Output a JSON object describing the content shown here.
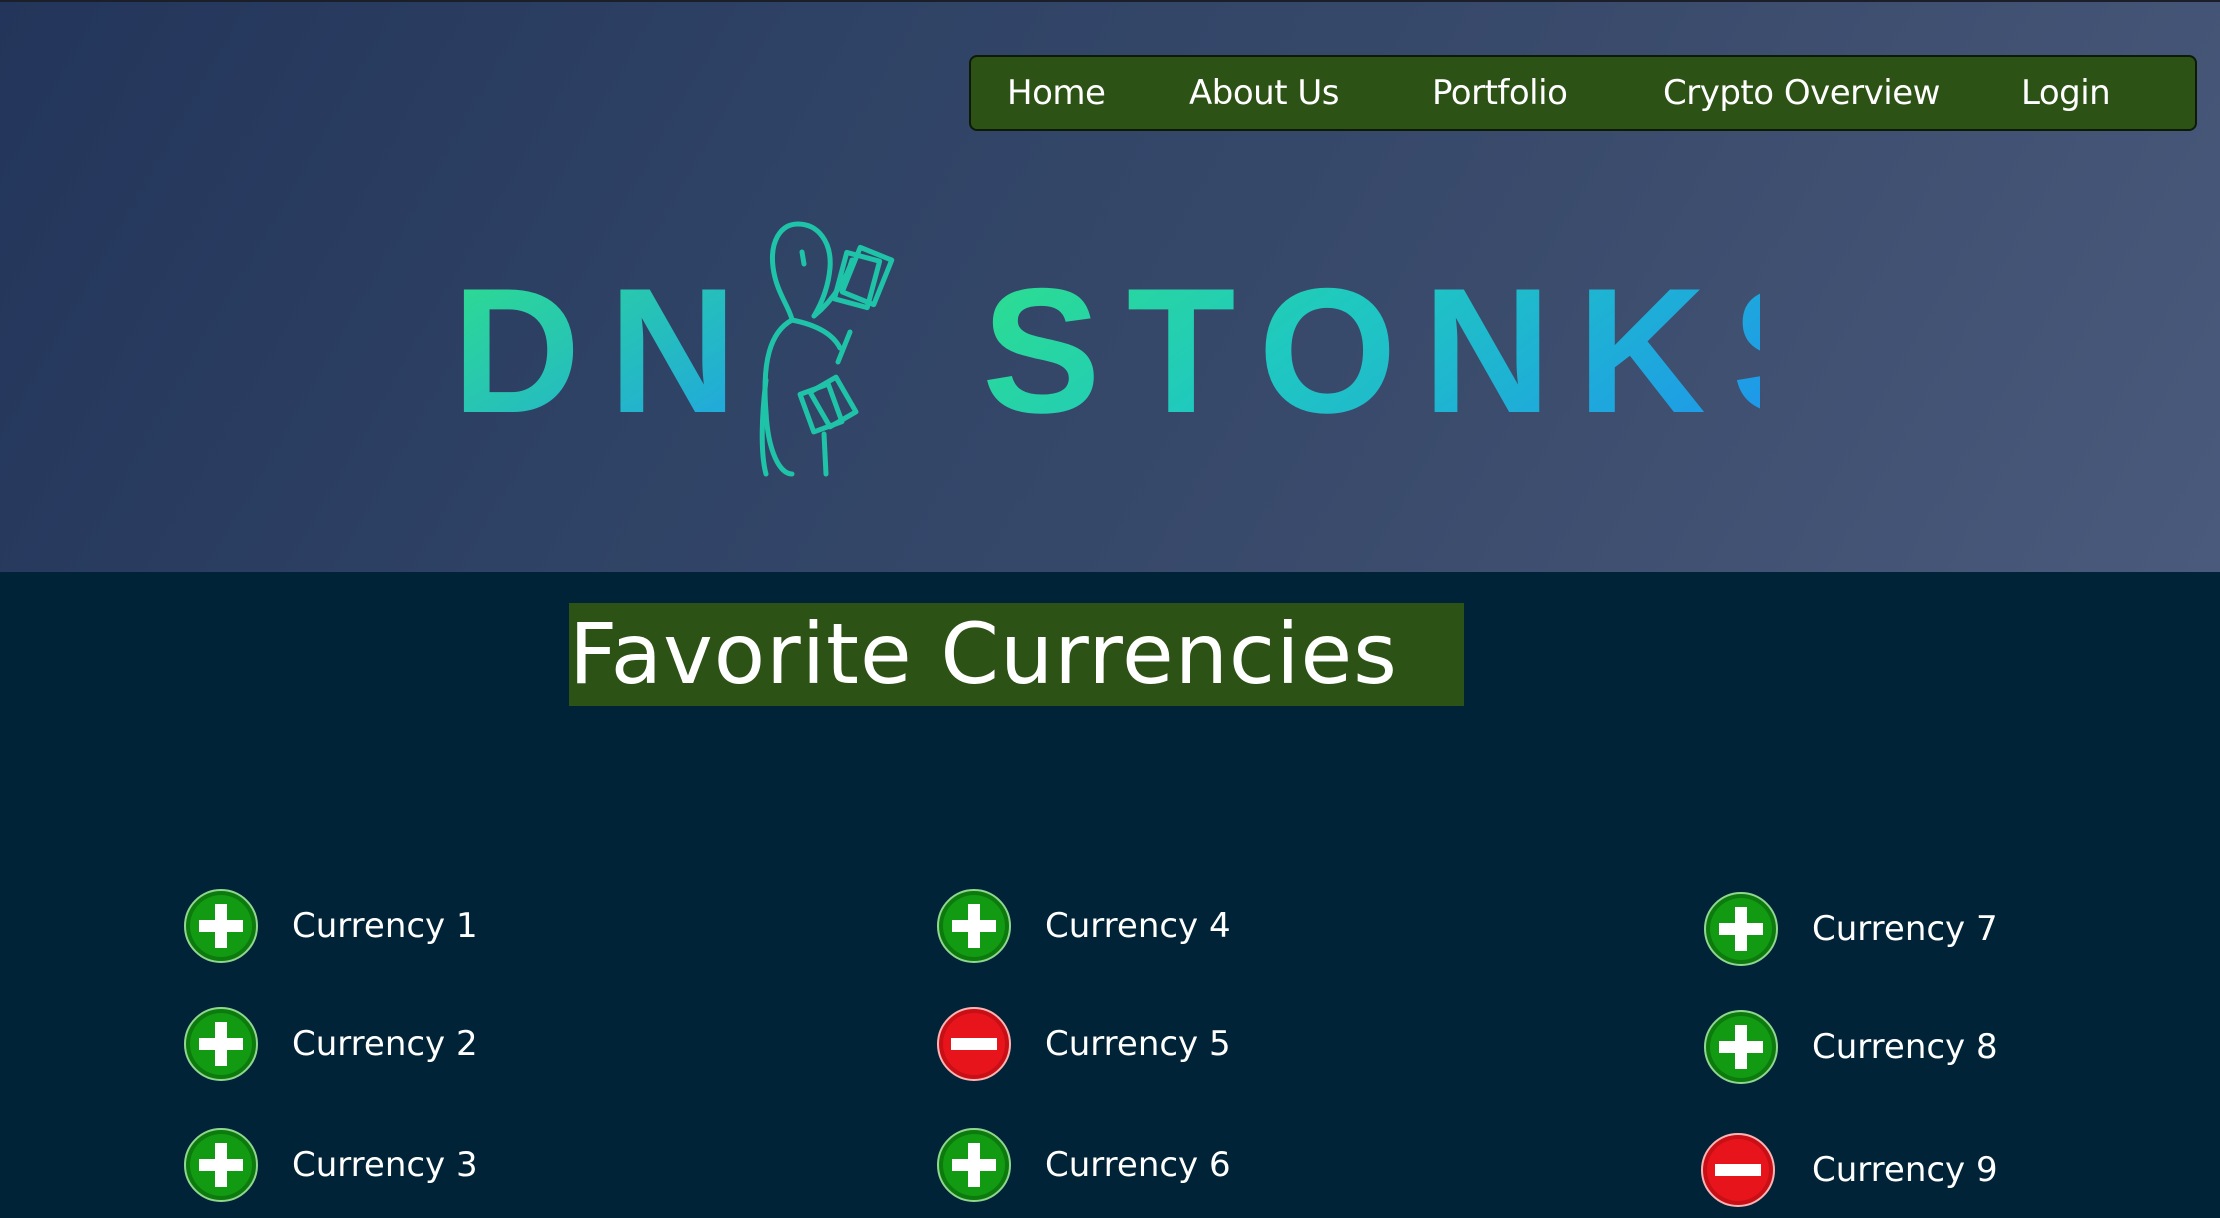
{
  "nav": {
    "items": [
      {
        "label": "Home"
      },
      {
        "label": "About Us"
      },
      {
        "label": "Portfolio"
      },
      {
        "label": "Crypto Overview"
      },
      {
        "label": "Login"
      }
    ]
  },
  "logo": {
    "text_left": "DN",
    "text_right": "STONKS",
    "icon": "person-holding-money-icon",
    "gradient_start": "#2ee08a",
    "gradient_end": "#1ea0ea"
  },
  "main": {
    "title": "Favorite Currencies",
    "currencies": [
      {
        "label": "Currency 1",
        "icon": "add-icon"
      },
      {
        "label": "Currency 2",
        "icon": "add-icon"
      },
      {
        "label": "Currency 3",
        "icon": "add-icon"
      },
      {
        "label": "Currency 4",
        "icon": "add-icon"
      },
      {
        "label": "Currency 5",
        "icon": "remove-icon"
      },
      {
        "label": "Currency 6",
        "icon": "add-icon"
      },
      {
        "label": "Currency 7",
        "icon": "add-icon"
      },
      {
        "label": "Currency 8",
        "icon": "add-icon"
      },
      {
        "label": "Currency 9",
        "icon": "remove-icon"
      }
    ]
  },
  "colors": {
    "nav_bg": "#2d5215",
    "page_bg": "#012337",
    "add_green": "#118a11",
    "remove_red": "#e0141c"
  }
}
